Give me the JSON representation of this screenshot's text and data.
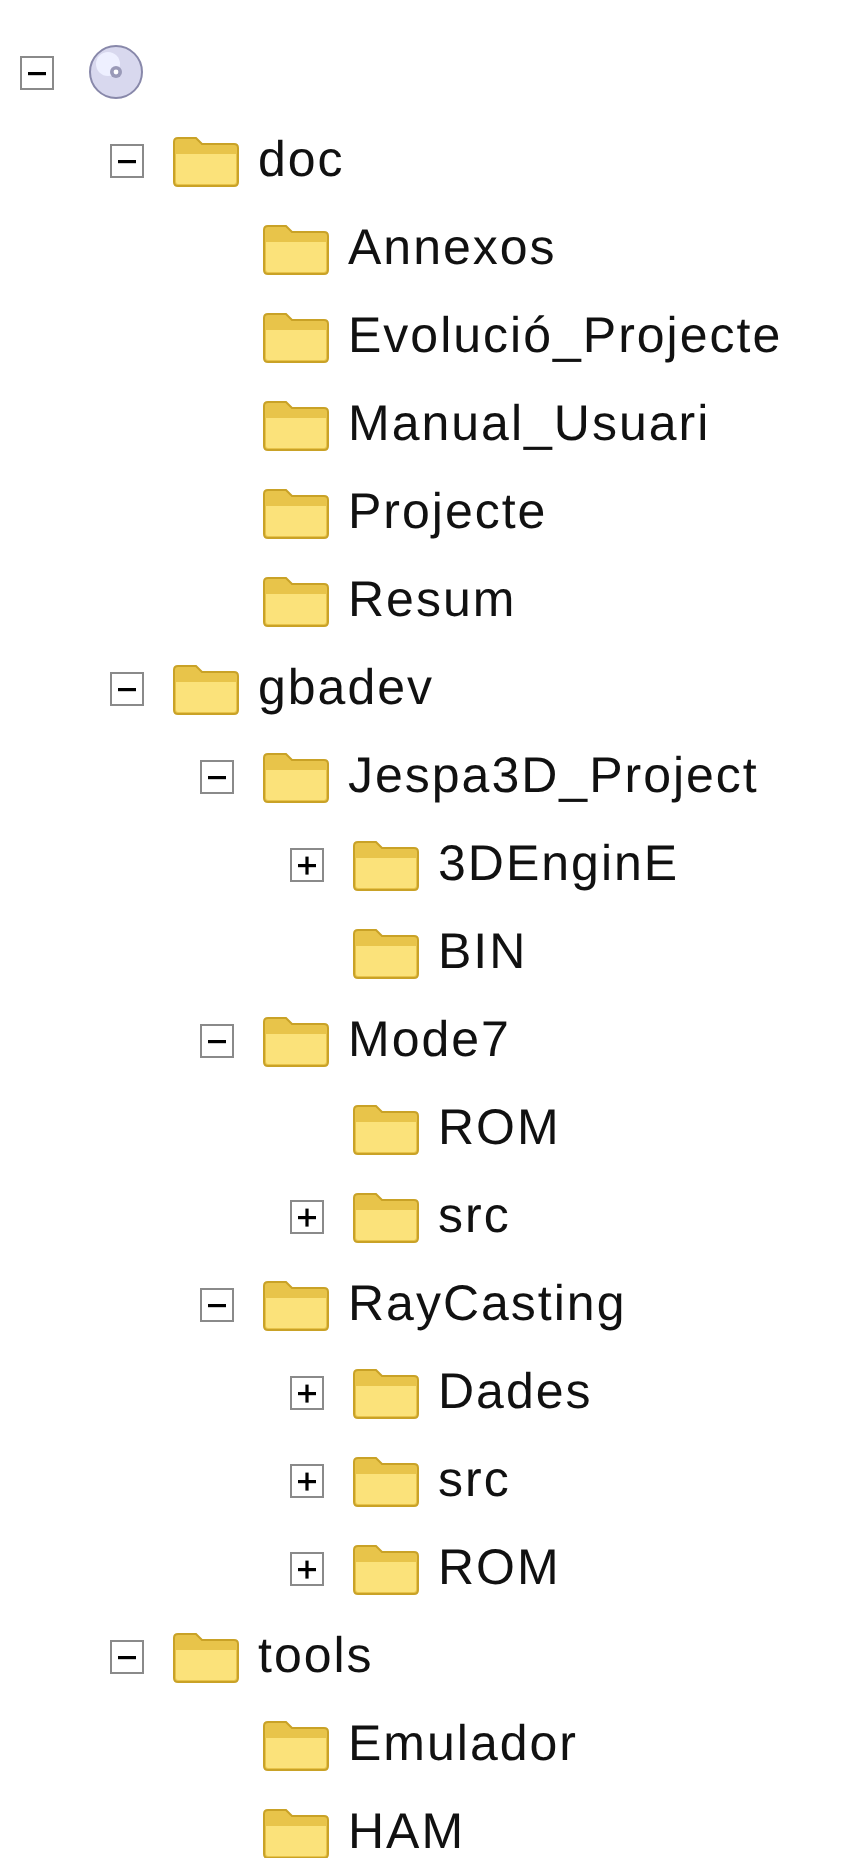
{
  "tree": [
    {
      "kind": "drive",
      "expanded": true,
      "children": [
        {
          "kind": "folder",
          "label": "doc",
          "expanded": true,
          "children": [
            {
              "kind": "folder",
              "label": "Annexos"
            },
            {
              "kind": "folder",
              "label": "Evolució_Projecte"
            },
            {
              "kind": "folder",
              "label": "Manual_Usuari"
            },
            {
              "kind": "folder",
              "label": "Projecte"
            },
            {
              "kind": "folder",
              "label": "Resum"
            }
          ]
        },
        {
          "kind": "folder",
          "label": "gbadev",
          "expanded": true,
          "children": [
            {
              "kind": "folder",
              "label": "Jespa3D_Project",
              "expanded": true,
              "children": [
                {
                  "kind": "folder",
                  "label": "3DEnginE",
                  "expanded": false
                },
                {
                  "kind": "folder",
                  "label": "BIN"
                }
              ]
            },
            {
              "kind": "folder",
              "label": "Mode7",
              "expanded": true,
              "children": [
                {
                  "kind": "folder",
                  "label": "ROM"
                },
                {
                  "kind": "folder",
                  "label": "src",
                  "expanded": false
                }
              ]
            },
            {
              "kind": "folder",
              "label": "RayCasting",
              "expanded": true,
              "children": [
                {
                  "kind": "folder",
                  "label": "Dades",
                  "expanded": false
                },
                {
                  "kind": "folder",
                  "label": "src",
                  "expanded": false
                },
                {
                  "kind": "folder",
                  "label": "ROM",
                  "expanded": false
                }
              ]
            }
          ]
        },
        {
          "kind": "folder",
          "label": "tools",
          "expanded": true,
          "children": [
            {
              "kind": "folder",
              "label": "Emulador"
            },
            {
              "kind": "folder",
              "label": "HAM"
            }
          ]
        }
      ]
    }
  ]
}
